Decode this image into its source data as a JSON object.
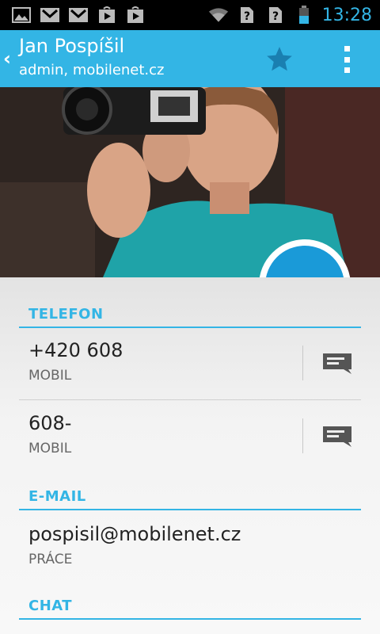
{
  "status_bar": {
    "time": "13:28",
    "notification_icons": [
      "gallery-icon",
      "gmail-icon",
      "gmail-icon",
      "play-store-icon",
      "play-store-icon"
    ],
    "system_icons": [
      "wifi-icon",
      "sim-unknown-icon",
      "sim-unknown-icon",
      "battery-icon"
    ]
  },
  "action_bar": {
    "title": "Jan Pospíšil",
    "subtitle": "admin, mobilenet.cz",
    "accent": "#33b5e5"
  },
  "sections": {
    "phone": {
      "header": "TELEFON"
    },
    "email": {
      "header": "E-MAIL"
    },
    "chat": {
      "header": "CHAT"
    }
  },
  "phones": [
    {
      "number": "+420 608",
      "type": "MOBIL"
    },
    {
      "number": "608-",
      "type": "MOBIL"
    }
  ],
  "emails": [
    {
      "address": "pospisil@mobilenet.cz",
      "type": "PRÁCE"
    }
  ]
}
